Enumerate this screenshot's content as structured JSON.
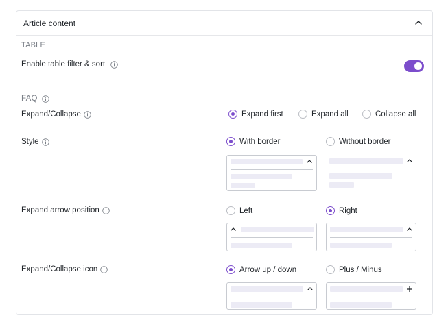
{
  "panel": {
    "title": "Article content",
    "collapse_icon": "chevron-up-icon"
  },
  "table": {
    "section_label": "TABLE",
    "filter_sort_label": "Enable table filter & sort",
    "filter_sort_enabled": true
  },
  "faq": {
    "section_label": "FAQ",
    "expand_collapse": {
      "label": "Expand/Collapse",
      "options": [
        "Expand first",
        "Expand all",
        "Collapse all"
      ],
      "selected": "Expand first"
    },
    "style": {
      "label": "Style",
      "options": [
        "With border",
        "Without border"
      ],
      "selected": "With border"
    },
    "arrow_position": {
      "label": "Expand arrow position",
      "options": [
        "Left",
        "Right"
      ],
      "selected": "Right"
    },
    "icon": {
      "label": "Expand/Collapse icon",
      "options": [
        "Arrow up / down",
        "Plus / Minus"
      ],
      "selected": "Arrow up / down"
    }
  },
  "colors": {
    "accent": "#7c4dcc",
    "preview_bar": "#ecebf5",
    "border": "#e2e4e8"
  }
}
